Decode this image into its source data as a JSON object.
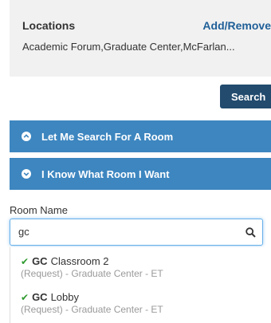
{
  "locations": {
    "title": "Locations",
    "add_remove": "Add/Remove",
    "value": "Academic Forum,Graduate Center,McFarlan..."
  },
  "search_button": "Search",
  "accordion": [
    {
      "label": "Let Me Search For A Room",
      "icon": "chevron-up-circle-icon"
    },
    {
      "label": "I Know What Room I Want",
      "icon": "chevron-down-circle-icon"
    }
  ],
  "room_name": {
    "label": "Room Name",
    "value": "gc"
  },
  "results": [
    {
      "code": "GC",
      "name": "Classroom 2",
      "detail": "(Request) - Graduate Center - ET"
    },
    {
      "code": "GC",
      "name": "Lobby",
      "detail": "(Request) - Graduate Center - ET"
    }
  ],
  "colors": {
    "accordion": "#3d86c0",
    "search_button": "#224b6e",
    "link": "#1f5f98",
    "check": "#2e9a2e"
  }
}
